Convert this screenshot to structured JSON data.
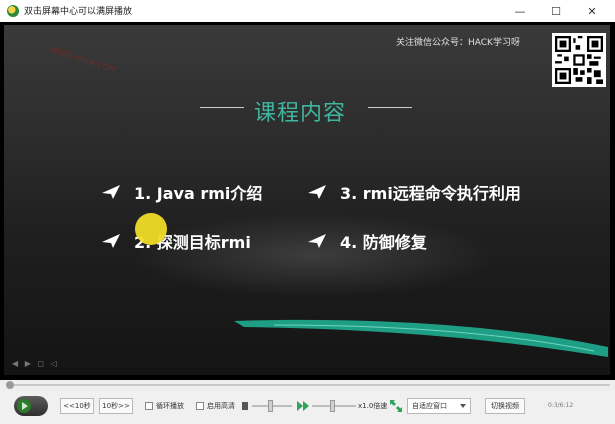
{
  "window": {
    "title": "双击屏幕中心可以满屏播放",
    "min_glyph": "—",
    "max_glyph": "☐",
    "close_glyph": "✕"
  },
  "slide": {
    "watermark": "WWW.HACK.COM",
    "follow_text": "关注微信公众号：HACK学习呀",
    "heading": "课程内容",
    "items": [
      {
        "label": "1. Java rmi介绍"
      },
      {
        "label": "2. 探测目标rmi"
      },
      {
        "label": "3. rmi远程命令执行利用"
      },
      {
        "label": "4. 防御修复"
      }
    ],
    "mini_controls": "◀ ▶ ◻ ◁"
  },
  "controls": {
    "back_label": "<<10秒",
    "forward_label": "10秒>>",
    "loop_label": "循环播放",
    "hd_label": "启用高清",
    "speed_label": "x1.0倍速",
    "fit_select": "自适应窗口",
    "switch_label": "切换视频",
    "time": "0:3/6:12"
  },
  "icons": {
    "app": "app-icon",
    "play": "play-icon",
    "volume": "volume-icon",
    "speed": "speed-icon",
    "fit": "fit-window-icon"
  },
  "colors": {
    "heading": "#3fb6a0",
    "accent_green": "#2fa35a",
    "swoosh": "#1f9e86"
  }
}
